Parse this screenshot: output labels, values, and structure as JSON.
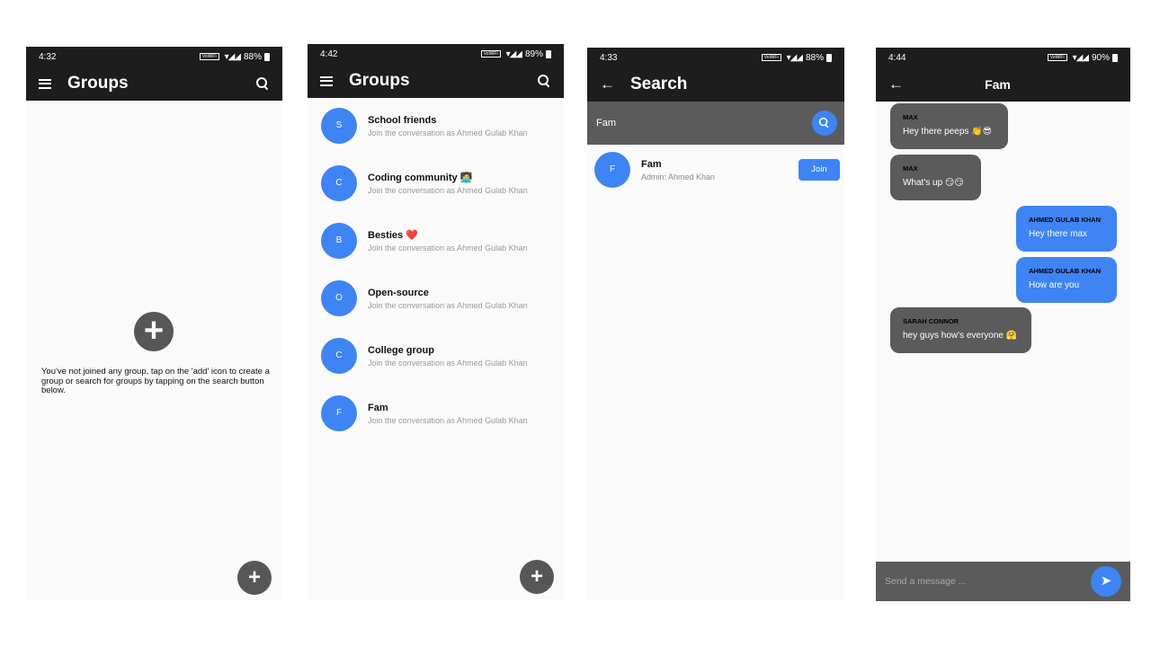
{
  "screen1": {
    "status": {
      "time": "4:32",
      "net": "VoWiFi",
      "battery": "88%"
    },
    "title": "Groups",
    "empty_message": "You've not joined any group, tap on the 'add' icon to create a group or search for groups by tapping on the search button below.",
    "add_glyph": "+",
    "fab_glyph": "+"
  },
  "screen2": {
    "status": {
      "time": "4:42",
      "net": "VoWiFi",
      "battery": "89%"
    },
    "title": "Groups",
    "fab_glyph": "+",
    "groups": [
      {
        "initial": "S",
        "name": "School friends",
        "subtitle": "Join the conversation as Ahmed Gulab Khan"
      },
      {
        "initial": "C",
        "name": "Coding community 🧑‍💻",
        "subtitle": "Join the conversation as Ahmed Gulab Khan"
      },
      {
        "initial": "B",
        "name": "Besties ❤️",
        "subtitle": "Join the conversation as Ahmed Gulab Khan"
      },
      {
        "initial": "O",
        "name": "Open-source",
        "subtitle": "Join the conversation as Ahmed Gulab Khan"
      },
      {
        "initial": "C",
        "name": "College group",
        "subtitle": "Join the conversation as Ahmed Gulab Khan"
      },
      {
        "initial": "F",
        "name": "Fam",
        "subtitle": "Join the conversation as Ahmed Gulab Khan"
      }
    ]
  },
  "screen3": {
    "status": {
      "time": "4:33",
      "net": "VoWiFi",
      "battery": "88%"
    },
    "title": "Search",
    "search_value": "Fam",
    "result": {
      "initial": "F",
      "name": "Fam",
      "admin": "Admin: Ahmed Khan",
      "join_label": "Join"
    }
  },
  "screen4": {
    "status": {
      "time": "4:44",
      "net": "VoWiFi",
      "battery": "90%"
    },
    "title": "Fam",
    "messages": [
      {
        "sender": "MAX",
        "text": "Hey there peeps 👏😎",
        "direction": "in"
      },
      {
        "sender": "MAX",
        "text": "What's up 😏😏",
        "direction": "in"
      },
      {
        "sender": "AHMED GULAB KHAN",
        "text": "Hey there max",
        "direction": "out"
      },
      {
        "sender": "AHMED GULAB KHAN",
        "text": "How are you",
        "direction": "out"
      },
      {
        "sender": "SARAH CONNOR",
        "text": "hey guys how's everyone 🤗",
        "direction": "in"
      }
    ],
    "compose_placeholder": "Send a message ...",
    "send_glyph": "➤"
  },
  "colors": {
    "appbar": "#1d1d1d",
    "accent": "#3e84f4",
    "grey": "#575757",
    "bubble_in": "#5b5b5b"
  }
}
